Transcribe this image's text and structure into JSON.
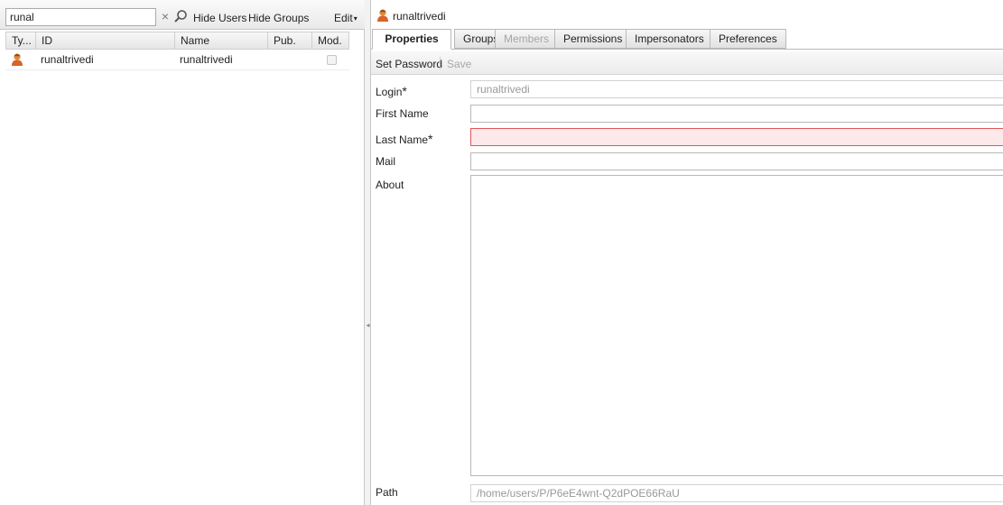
{
  "left_toolbar": {
    "search_value": "runal",
    "clear_icon": "×",
    "hide_users": "Hide Users",
    "hide_groups": "Hide Groups",
    "edit_menu": "Edit",
    "edit_caret": "▾"
  },
  "grid": {
    "columns": {
      "type": "Ty...",
      "id": "ID",
      "name": "Name",
      "pub": "Pub.",
      "mod": "Mod."
    },
    "rows": [
      {
        "icon": "user-icon",
        "id": "runaltrivedi",
        "name": "runaltrivedi",
        "mod": false
      }
    ]
  },
  "splitter": {
    "grip": "◂"
  },
  "detail": {
    "title": "runaltrivedi",
    "title_icon": "user-icon",
    "tabs": {
      "properties": "Properties",
      "groups": "Groups",
      "members": "Members",
      "permissions": "Permissions",
      "impersonators": "Impersonators",
      "preferences": "Preferences"
    },
    "active_tab": "Properties",
    "actions": {
      "set_password": "Set Password",
      "save": "Save"
    },
    "form": {
      "login_label": "Login",
      "required_mark": "*",
      "login_value": "runaltrivedi",
      "first_name_label": "First Name",
      "first_name_value": "",
      "last_name_label": "Last Name",
      "last_name_value": "",
      "mail_label": "Mail",
      "mail_value": "",
      "about_label": "About",
      "about_value": "",
      "path_label": "Path",
      "path_value": "/home/users/P/P6eE4wnt-Q2dPOE66RaU"
    }
  },
  "colors": {
    "invalid_background": "#fde9e9",
    "invalid_border": "#e25555",
    "user_icon": "#d7642a"
  }
}
